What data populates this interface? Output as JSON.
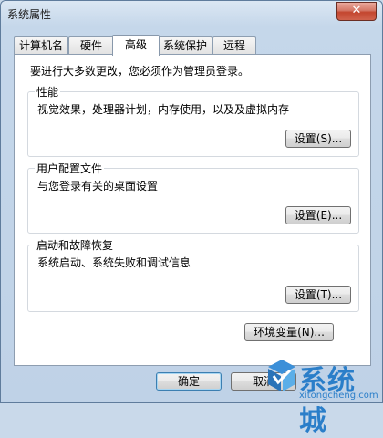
{
  "window": {
    "title": "系统属性"
  },
  "tabs": [
    {
      "label": "计算机名"
    },
    {
      "label": "硬件"
    },
    {
      "label": "高级"
    },
    {
      "label": "系统保护"
    },
    {
      "label": "远程"
    }
  ],
  "active_tab": "高级",
  "intro": "要进行大多数更改，您必须作为管理员登录。",
  "groups": {
    "performance": {
      "title": "性能",
      "desc": "视觉效果，处理器计划，内存使用，以及及虚拟内存",
      "button": "设置(S)..."
    },
    "profile": {
      "title": "用户配置文件",
      "desc": "与您登录有关的桌面设置",
      "button": "设置(E)..."
    },
    "startup": {
      "title": "启动和故障恢复",
      "desc": "系统启动、系统失败和调试信息",
      "button": "设置(T)..."
    }
  },
  "env_button": "环境变量(N)...",
  "footer": {
    "ok": "确定",
    "cancel": "取消"
  },
  "watermark": {
    "brand": "系统城",
    "url": "xitongcheng.com"
  },
  "colors": {
    "accent": "#2a7ec9",
    "close": "#c3462f"
  }
}
